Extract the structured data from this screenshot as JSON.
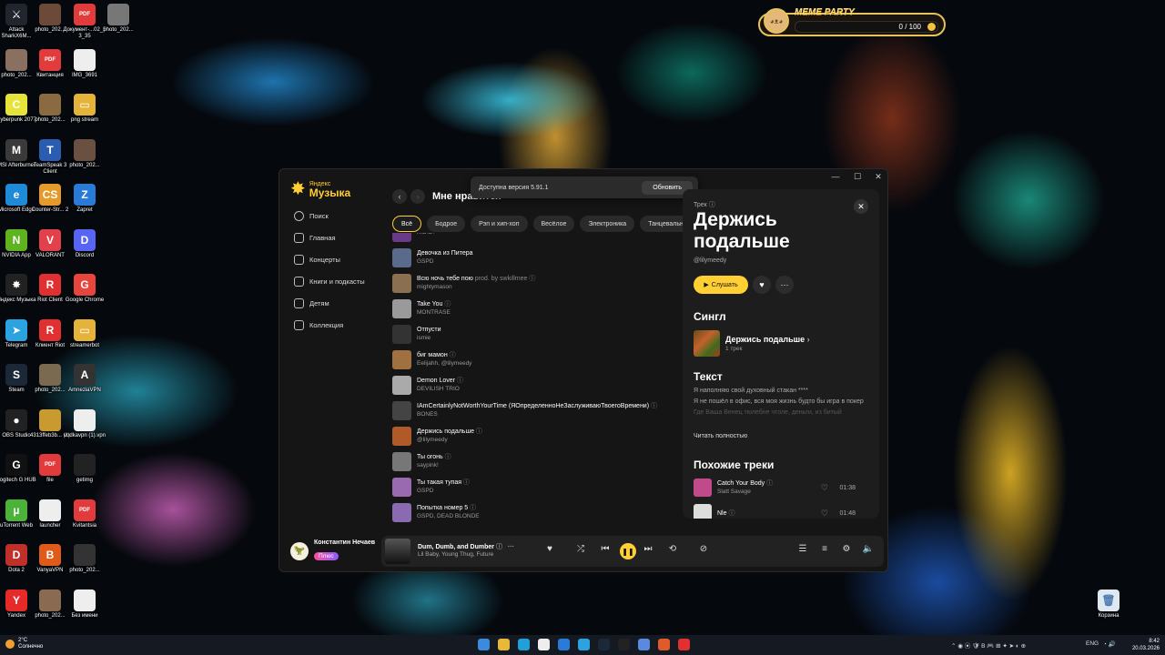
{
  "desktop": {
    "icons": [
      {
        "label": "Attack SharkX6M...",
        "color": "#20252e",
        "glyph": "⚔"
      },
      {
        "label": "photo_202...",
        "color": "#6b4a3a",
        "glyph": ""
      },
      {
        "label": "Документ-...02_53_35",
        "color": "#e23b3b",
        "glyph": "PDF"
      },
      {
        "label": "photo_202...",
        "color": "#777",
        "glyph": ""
      },
      {
        "label": "photo_202...",
        "color": "#8a7060",
        "glyph": ""
      },
      {
        "label": "Квитанция",
        "color": "#e23b3b",
        "glyph": "PDF"
      },
      {
        "label": "IMG_3691",
        "color": "#eee",
        "glyph": ""
      },
      {
        "label": "Cyberpunk 2077",
        "color": "#e6e33a",
        "glyph": "C"
      },
      {
        "label": "photo_202...",
        "color": "#8a6a40",
        "glyph": ""
      },
      {
        "label": "png stream",
        "color": "#e5b33a",
        "glyph": "▭"
      },
      {
        "label": "MSI Afterburner",
        "color": "#3a3a3a",
        "glyph": "M"
      },
      {
        "label": "TeamSpeak 3 Client",
        "color": "#2a5db0",
        "glyph": "T"
      },
      {
        "label": "photo_202...",
        "color": "#6a5040",
        "glyph": ""
      },
      {
        "label": "Microsoft Edge",
        "color": "#1f8ad8",
        "glyph": "e"
      },
      {
        "label": "Counter-Str... 2",
        "color": "#e59a2a",
        "glyph": "CS"
      },
      {
        "label": "Zapret",
        "color": "#2a7ad8",
        "glyph": "Z"
      },
      {
        "label": "NVIDIA App",
        "color": "#5fb31e",
        "glyph": "N"
      },
      {
        "label": "VALORANT",
        "color": "#e2414b",
        "glyph": "V"
      },
      {
        "label": "Discord",
        "color": "#5865f2",
        "glyph": "D"
      },
      {
        "label": "Яндекс Музыка",
        "color": "#222",
        "glyph": "✸"
      },
      {
        "label": "Riot Client",
        "color": "#e03030",
        "glyph": "R"
      },
      {
        "label": "Google Chrome",
        "color": "#e8453c",
        "glyph": "G"
      },
      {
        "label": "Telegram",
        "color": "#2aa3e0",
        "glyph": "➤"
      },
      {
        "label": "Клиент Riot",
        "color": "#e03030",
        "glyph": "R"
      },
      {
        "label": "streamerbot",
        "color": "#e5b33a",
        "glyph": "▭"
      },
      {
        "label": "Steam",
        "color": "#1b2838",
        "glyph": "S"
      },
      {
        "label": "photo_202...",
        "color": "#7a6a50",
        "glyph": ""
      },
      {
        "label": "AmneziaVPN",
        "color": "#333",
        "glyph": "A"
      },
      {
        "label": "OBS Studio",
        "color": "#222",
        "glyph": "●"
      },
      {
        "label": "4313ffeb3b... (1)",
        "color": "#c89a30",
        "glyph": ""
      },
      {
        "label": "vodkavpn (1).vpn",
        "color": "#eee",
        "glyph": ""
      },
      {
        "label": "Logitech G HUB",
        "color": "#111",
        "glyph": "G"
      },
      {
        "label": "file",
        "color": "#e23b3b",
        "glyph": "PDF"
      },
      {
        "label": "getimg",
        "color": "#222",
        "glyph": ""
      },
      {
        "label": "uTorrent Web",
        "color": "#4bb33a",
        "glyph": "µ"
      },
      {
        "label": "launcher",
        "color": "#eee",
        "glyph": ""
      },
      {
        "label": "Kvitantsia",
        "color": "#e23b3b",
        "glyph": "PDF"
      },
      {
        "label": "Dota 2",
        "color": "#c0302a",
        "glyph": "D"
      },
      {
        "label": "VanyaVPN",
        "color": "#e05a1a",
        "glyph": "B"
      },
      {
        "label": "photo_202...",
        "color": "#333",
        "glyph": ""
      },
      {
        "label": "Yandex",
        "color": "#e62a2a",
        "glyph": "Y"
      },
      {
        "label": "photo_202...",
        "color": "#8a6a50",
        "glyph": ""
      },
      {
        "label": "Без имени",
        "color": "#eee",
        "glyph": ""
      }
    ],
    "recycle_bin": "Корзина"
  },
  "meme_party": {
    "title": "MEME PARTY",
    "progress": "0 / 100",
    "progress_fraction": 0
  },
  "app": {
    "logo_small": "Яндекс",
    "logo_big": "Музыка",
    "nav": [
      "Поиск",
      "Главная",
      "Концерты",
      "Книги и подкасты",
      "Детям",
      "Коллекция"
    ],
    "user": {
      "name": "Константин Нечаев",
      "badge": "Плюс"
    },
    "page_title": "Мне нравится",
    "update": {
      "text": "Доступна версия 5.91.1",
      "button": "Обновить"
    },
    "chips": [
      "Всё",
      "Бодрое",
      "Рэп и хип-хоп",
      "Весёлое",
      "Электроника",
      "Танцевальна"
    ],
    "tracks": [
      {
        "title": "",
        "artist": "K.D.D.",
        "extra": "",
        "c": "#6a3a8a"
      },
      {
        "title": "Девочка из Питера",
        "artist": "GSPD",
        "extra": "",
        "c": "#5a6a8a"
      },
      {
        "title": "Всю ночь тебе пою",
        "artist": "mightymason",
        "extra": " prod. by swkillmee",
        "c": "#8a7050"
      },
      {
        "title": "Take You",
        "artist": "MONTRASE",
        "extra": "",
        "c": "#9a9a9a"
      },
      {
        "title": "Отпусти",
        "artist": "ismie",
        "extra": "",
        "c": "#333"
      },
      {
        "title": "биг мамон",
        "artist": "Eelijahh, @lilymeedy",
        "extra": "",
        "c": "#a07040"
      },
      {
        "title": "Demon Lover",
        "artist": "DEVILISH TRIO",
        "extra": "",
        "c": "#aaa"
      },
      {
        "title": "IAmCertainlyNotWorthYourTime (ЯОпределенноНеЗаслуживаюТвоегоВремени)",
        "artist": "BONES",
        "extra": "",
        "c": "#444"
      },
      {
        "title": "Держись подальше",
        "artist": "@lilymeedy",
        "extra": "",
        "c": "#b05a2a"
      },
      {
        "title": "Ты огонь",
        "artist": "saypink!",
        "extra": "",
        "c": "#777"
      },
      {
        "title": "Ты такая тупая",
        "artist": "GSPD",
        "extra": "",
        "c": "#9a6ab0"
      },
      {
        "title": "Попытка номер 5",
        "artist": "GSPD, DEAD BLONDE",
        "extra": "",
        "c": "#8a6ab0"
      }
    ],
    "panel": {
      "type": "Трек",
      "title": "Держись подальше",
      "artist": "@lilymeedy",
      "listen": "Слушать",
      "single_header": "Сингл",
      "single_name": "Держись подальше",
      "single_sub": "1 трек",
      "lyrics_header": "Текст",
      "lyrics": [
        "Я наполняю свой духовный стакан ****",
        "Я не пошёл в офис, вся моя жизнь будто бы игра в покер",
        "Где Ваша Венец тюлебне чтоле, деньги, из битый"
      ],
      "read_all": "Читать полностью",
      "similar_header": "Похожие треки",
      "similar": [
        {
          "title": "Catch Your Body",
          "artist": "Slatt Savage",
          "duration": "01:38",
          "c": "#c04a8a"
        },
        {
          "title": "Nle",
          "artist": "",
          "duration": "01:48",
          "c": "#ddd"
        }
      ]
    },
    "player": {
      "title": "Dum, Dumb, and Dumber",
      "artist": "Lil Baby, Young Thug, Future"
    }
  },
  "taskbar": {
    "weather_temp": "2°C",
    "weather_text": "Солнечно",
    "lang": "ENG",
    "time": "8:42",
    "date": "20.03.2026"
  }
}
